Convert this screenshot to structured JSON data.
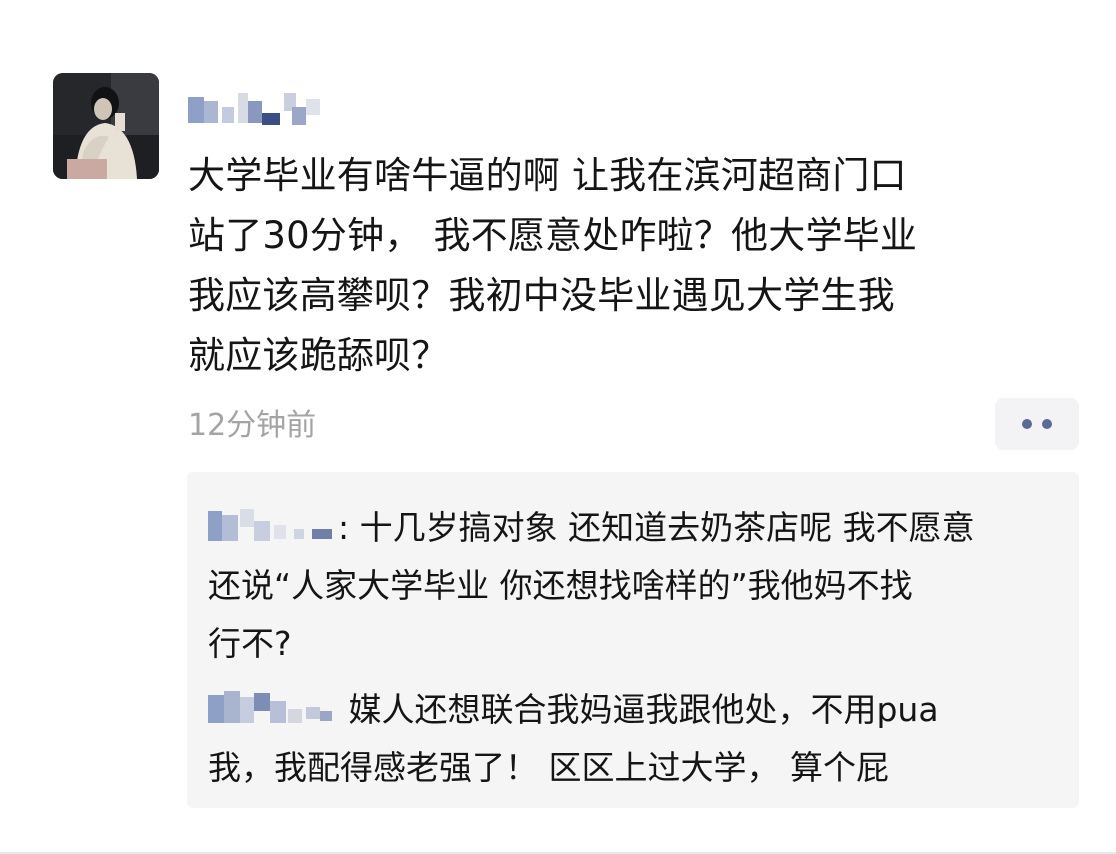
{
  "post": {
    "avatar_icon": "avatar-photo",
    "username_label": "blurred-username",
    "text_lines": [
      "大学毕业有啥牛逼的啊 让我在滨河超商门口",
      "站了30分钟， 我不愿意处咋啦？他大学毕业",
      "我应该高攀呗？我初中没毕业遇见大学生我",
      "就应该跪舔呗？"
    ],
    "timestamp": "12分钟前",
    "more_icon": "ellipsis-icon"
  },
  "comments": [
    {
      "separator": ":",
      "first_line": " 十几岁搞对象 还知道去奶茶店呢 我不愿意",
      "lines": [
        "还说“人家大学毕业 你还想找啥样的”我他妈不找",
        "行不?"
      ]
    },
    {
      "separator": "",
      "first_line": " 媒人还想联合我妈逼我跟他处，不用pua",
      "lines": [
        "我，我配得感老强了！ 区区上过大学， 算个屁"
      ]
    }
  ],
  "colors": {
    "text": "#151515",
    "timestamp": "#a4a4a4",
    "more_dots": "#5b6a92",
    "comment_bg": "#f5f5f5",
    "mosaic_blue": "#8fa0c6",
    "mosaic_navy": "#3b4f86",
    "mosaic_grey": "#d4d7de"
  }
}
